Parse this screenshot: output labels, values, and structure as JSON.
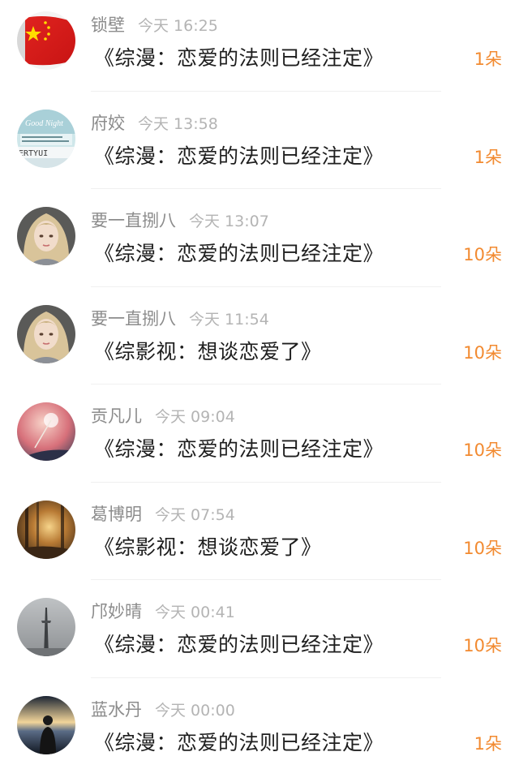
{
  "items": [
    {
      "name": "锁壁",
      "time": "今天 16:25",
      "title": "《综漫：恋爱的法则已经注定》",
      "gift": "1朵",
      "avatar_icon": "china-flag-avatar"
    },
    {
      "name": "府姣",
      "time": "今天 13:58",
      "title": "《综漫：恋爱的法则已经注定》",
      "gift": "1朵",
      "avatar_icon": "good-night-keyboard-avatar"
    },
    {
      "name": "要一直捌八",
      "time": "今天 13:07",
      "title": "《综漫：恋爱的法则已经注定》",
      "gift": "10朵",
      "avatar_icon": "illustrated-girl-avatar"
    },
    {
      "name": "要一直捌八",
      "time": "今天 11:54",
      "title": "《综影视：想谈恋爱了》",
      "gift": "10朵",
      "avatar_icon": "illustrated-girl-avatar"
    },
    {
      "name": "贡凡儿",
      "time": "今天 09:04",
      "title": "《综漫：恋爱的法则已经注定》",
      "gift": "10朵",
      "avatar_icon": "dandelion-avatar"
    },
    {
      "name": "葛博明",
      "time": "今天 07:54",
      "title": "《综影视：想谈恋爱了》",
      "gift": "10朵",
      "avatar_icon": "forest-sunlight-avatar"
    },
    {
      "name": "邝妙晴",
      "time": "今天 00:41",
      "title": "《综漫：恋爱的法则已经注定》",
      "gift": "10朵",
      "avatar_icon": "foggy-tower-avatar"
    },
    {
      "name": "蓝水丹",
      "time": "今天 00:00",
      "title": "《综漫：恋爱的法则已经注定》",
      "gift": "1朵",
      "avatar_icon": "silhouette-sunset-avatar"
    }
  ],
  "colors": {
    "name": "#8c8c8c",
    "time": "#b4b4b4",
    "title": "#1e1e1e",
    "gift": "#f28a30"
  }
}
